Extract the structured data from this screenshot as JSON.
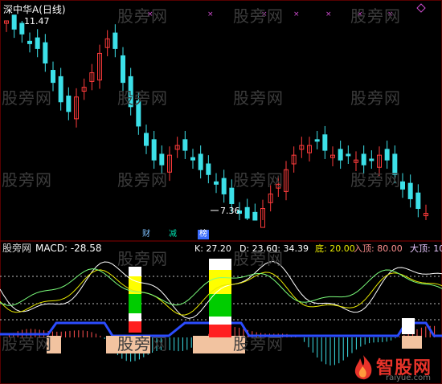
{
  "header": {
    "title": "深中华A(日线)",
    "price_label_high": "11.47",
    "price_label_low": "7.36",
    "tags": [
      "财",
      "减",
      "榜"
    ]
  },
  "indicator": {
    "source": "股旁网",
    "macd_text": "MACD: -28.58",
    "k_text": "K: 27.20",
    "d_text": "D: 23.60",
    "j_text": "J: 34.39",
    "di_text": "底: 20.00",
    "ru_ding_text": "入顶: 80.00",
    "da_ding_text": "大顶: 10"
  },
  "watermarks": [
    "股旁网",
    "股旁网",
    "股旁网",
    "股旁网",
    "股旁网",
    "股旁网",
    "股旁网",
    "股旁网",
    "股旁网",
    "股旁网",
    "股旁网",
    "股旁网",
    "股旁网",
    "股旁网",
    "股旁网",
    "股旁网"
  ],
  "logo": {
    "main": "智股网",
    "sub": "raiyue.com"
  },
  "colors": {
    "up": "#ff3b3b",
    "down": "#3ce0e8",
    "k": "#ffffff",
    "d": "#e8e800",
    "j": "#ff44ff",
    "green": "#00cc00",
    "white_line": "#ffffff"
  },
  "chart_data": {
    "type": "candlestick",
    "high": 11.47,
    "low": 7.36,
    "closes": [
      11.47,
      11.3,
      11.2,
      11.0,
      10.9,
      10.6,
      10.2,
      9.8,
      9.6,
      9.9,
      10.1,
      10.4,
      10.8,
      11.1,
      10.9,
      10.2,
      9.7,
      9.3,
      8.9,
      8.6,
      8.5,
      8.7,
      8.9,
      8.8,
      8.6,
      8.4,
      8.3,
      8.1,
      7.9,
      7.7,
      7.5,
      7.4,
      7.36,
      7.6,
      7.9,
      8.1,
      8.4,
      8.7,
      8.9,
      8.9,
      9.0,
      8.8,
      8.7,
      8.6,
      8.7,
      8.6,
      8.5,
      8.6,
      8.7,
      8.6,
      8.3,
      8.0,
      7.8,
      7.6,
      7.5
    ]
  }
}
